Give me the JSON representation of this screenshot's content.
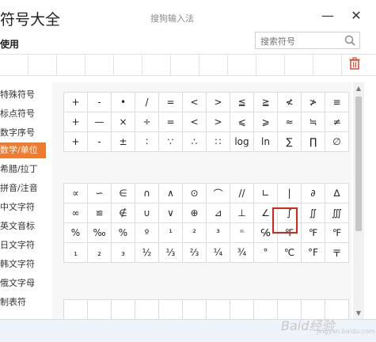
{
  "window": {
    "app_title": "符号大全",
    "ime_title": "搜狗输入法",
    "minimize_glyph": "—",
    "close_glyph": "✕"
  },
  "recent": {
    "label": "使用"
  },
  "search": {
    "placeholder": "搜索符号"
  },
  "sidebar": {
    "items": [
      {
        "label": "特殊符号",
        "active": false
      },
      {
        "label": "标点符号",
        "active": false
      },
      {
        "label": "数字序号",
        "active": false
      },
      {
        "label": "数学/单位",
        "active": true
      },
      {
        "label": "希腊/拉丁",
        "active": false
      },
      {
        "label": "拼音/注音",
        "active": false
      },
      {
        "label": "中文字符",
        "active": false
      },
      {
        "label": "英文音标",
        "active": false
      },
      {
        "label": "日文字符",
        "active": false
      },
      {
        "label": "韩文字符",
        "active": false
      },
      {
        "label": "俄文字母",
        "active": false
      },
      {
        "label": "制表符",
        "active": false
      }
    ]
  },
  "grid1": [
    [
      "+",
      "-",
      "•",
      "/",
      "=",
      "<",
      ">",
      "≦",
      "≧",
      "≮",
      "≯",
      "≡"
    ],
    [
      "+",
      "—",
      "×",
      "÷",
      "=",
      "<",
      ">",
      "⩽",
      "⩾",
      "≈",
      "≒",
      "≠"
    ],
    [
      "+",
      "-",
      "±",
      "∶",
      "∵",
      "∴",
      "∷",
      "log",
      "ln",
      "∑",
      "∏",
      "∅"
    ]
  ],
  "grid2": [
    [
      "∝",
      "∽",
      "∈",
      "∩",
      "∧",
      "⊙",
      "⌒",
      "//",
      "∟",
      "|",
      "∂",
      "∆"
    ],
    [
      "∞",
      "≌",
      "∉",
      "∪",
      "∨",
      "⊕",
      "⊿",
      "⊥",
      "∠",
      "∫",
      "∬",
      "∭"
    ],
    [
      "%",
      "‰",
      "%",
      "º",
      "¹",
      "²",
      "³",
      "ⁿ",
      "℅",
      "℉",
      "℉",
      "℉"
    ],
    [
      "₁",
      "₂",
      "₃",
      "½",
      "⅓",
      "⅔",
      "¼",
      "¾",
      "°",
      "℃",
      "°F",
      "〒"
    ]
  ],
  "grid3": [
    [
      "",
      "",
      "",
      "",
      "",
      "",
      "",
      "",
      "",
      "",
      "",
      ""
    ]
  ],
  "watermark": {
    "text": "Baid经验",
    "sub": "jingyan.baidu.com"
  },
  "colors": {
    "accent": "#f07b2f",
    "highlight": "#d9261c",
    "trash": "#e0492b"
  }
}
